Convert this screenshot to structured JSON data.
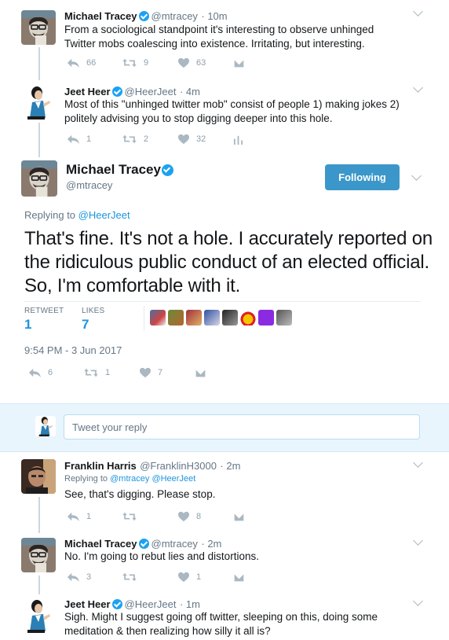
{
  "tweets": [
    {
      "name": "Michael Tracey",
      "handle": "@mtracey",
      "time": "· 10m",
      "text": "From a sociological standpoint it's interesting to observe unhinged Twitter mobs coalescing into existence. Irritating, but interesting.",
      "reply_count": "66",
      "retweet_count": "9",
      "like_count": "63"
    },
    {
      "name": "Jeet Heer",
      "handle": "@HeerJeet",
      "time": "· 4m",
      "text": "Most of this \"unhinged twitter mob\" consist of people 1) making jokes 2) politely advising you to stop digging deeper into this hole.",
      "reply_count": "1",
      "retweet_count": "2",
      "like_count": "32"
    }
  ],
  "main_tweet": {
    "name": "Michael Tracey",
    "handle": "@mtracey",
    "follow_label": "Following",
    "replying_prefix": "Replying to",
    "replying_to": "@HeerJeet",
    "text": "That's fine. It's not a hole. I accurately reported on the ridiculous public conduct of an elected official. So, I'm comfortable with it.",
    "retweets_label": "RETWEET",
    "retweets_value": "1",
    "likes_label": "LIKES",
    "likes_value": "7",
    "timestamp": "9:54 PM - 3 Jun 2017",
    "reply_count": "6",
    "retweet_count": "1",
    "like_count": "7"
  },
  "compose": {
    "placeholder": "Tweet your reply"
  },
  "replies": [
    {
      "name": "Franklin Harris",
      "handle": "@FranklinH3000",
      "time": "· 2m",
      "replying_prefix": "Replying to",
      "replying_to": "@mtracey @HeerJeet",
      "text": "See, that's digging. Please stop.",
      "reply_count": "1",
      "retweet_count": "",
      "like_count": "8"
    },
    {
      "name": "Michael Tracey",
      "handle": "@mtracey",
      "time": "· 2m",
      "text": "No. I'm going to rebut lies and distortions.",
      "reply_count": "3",
      "retweet_count": "",
      "like_count": "1"
    },
    {
      "name": "Jeet Heer",
      "handle": "@HeerJeet",
      "time": "· 1m",
      "text": "Sigh. Might I suggest going off twitter, sleeping on this, doing some meditation & then realizing how silly it all is?"
    }
  ],
  "colors": {
    "accent": "#1da1f2",
    "follow_button": "#3b97c9",
    "like_heart": "#aab8c2"
  }
}
